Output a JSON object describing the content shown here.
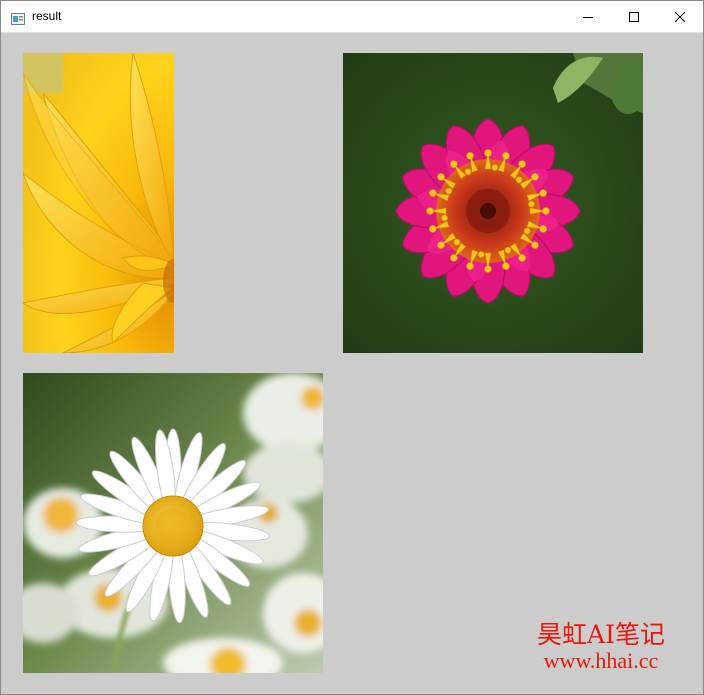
{
  "window": {
    "title": "result",
    "controls": {
      "minimize": "minimize-icon",
      "maximize": "maximize-icon",
      "close": "close-icon"
    }
  },
  "images": [
    {
      "name": "yellow-flower-image",
      "subject": "yellow dahlia petals (cropped)"
    },
    {
      "name": "pink-flower-image",
      "subject": "magenta zinnia with yellow center"
    },
    {
      "name": "daisy-image",
      "subject": "white daisies with yellow centers"
    }
  ],
  "watermark": {
    "line1": "昊虹AI笔记",
    "line2": "www.hhai.cc",
    "color": "#e8180c"
  },
  "colors": {
    "background": "#cccccc",
    "titlebar": "#ffffff"
  }
}
